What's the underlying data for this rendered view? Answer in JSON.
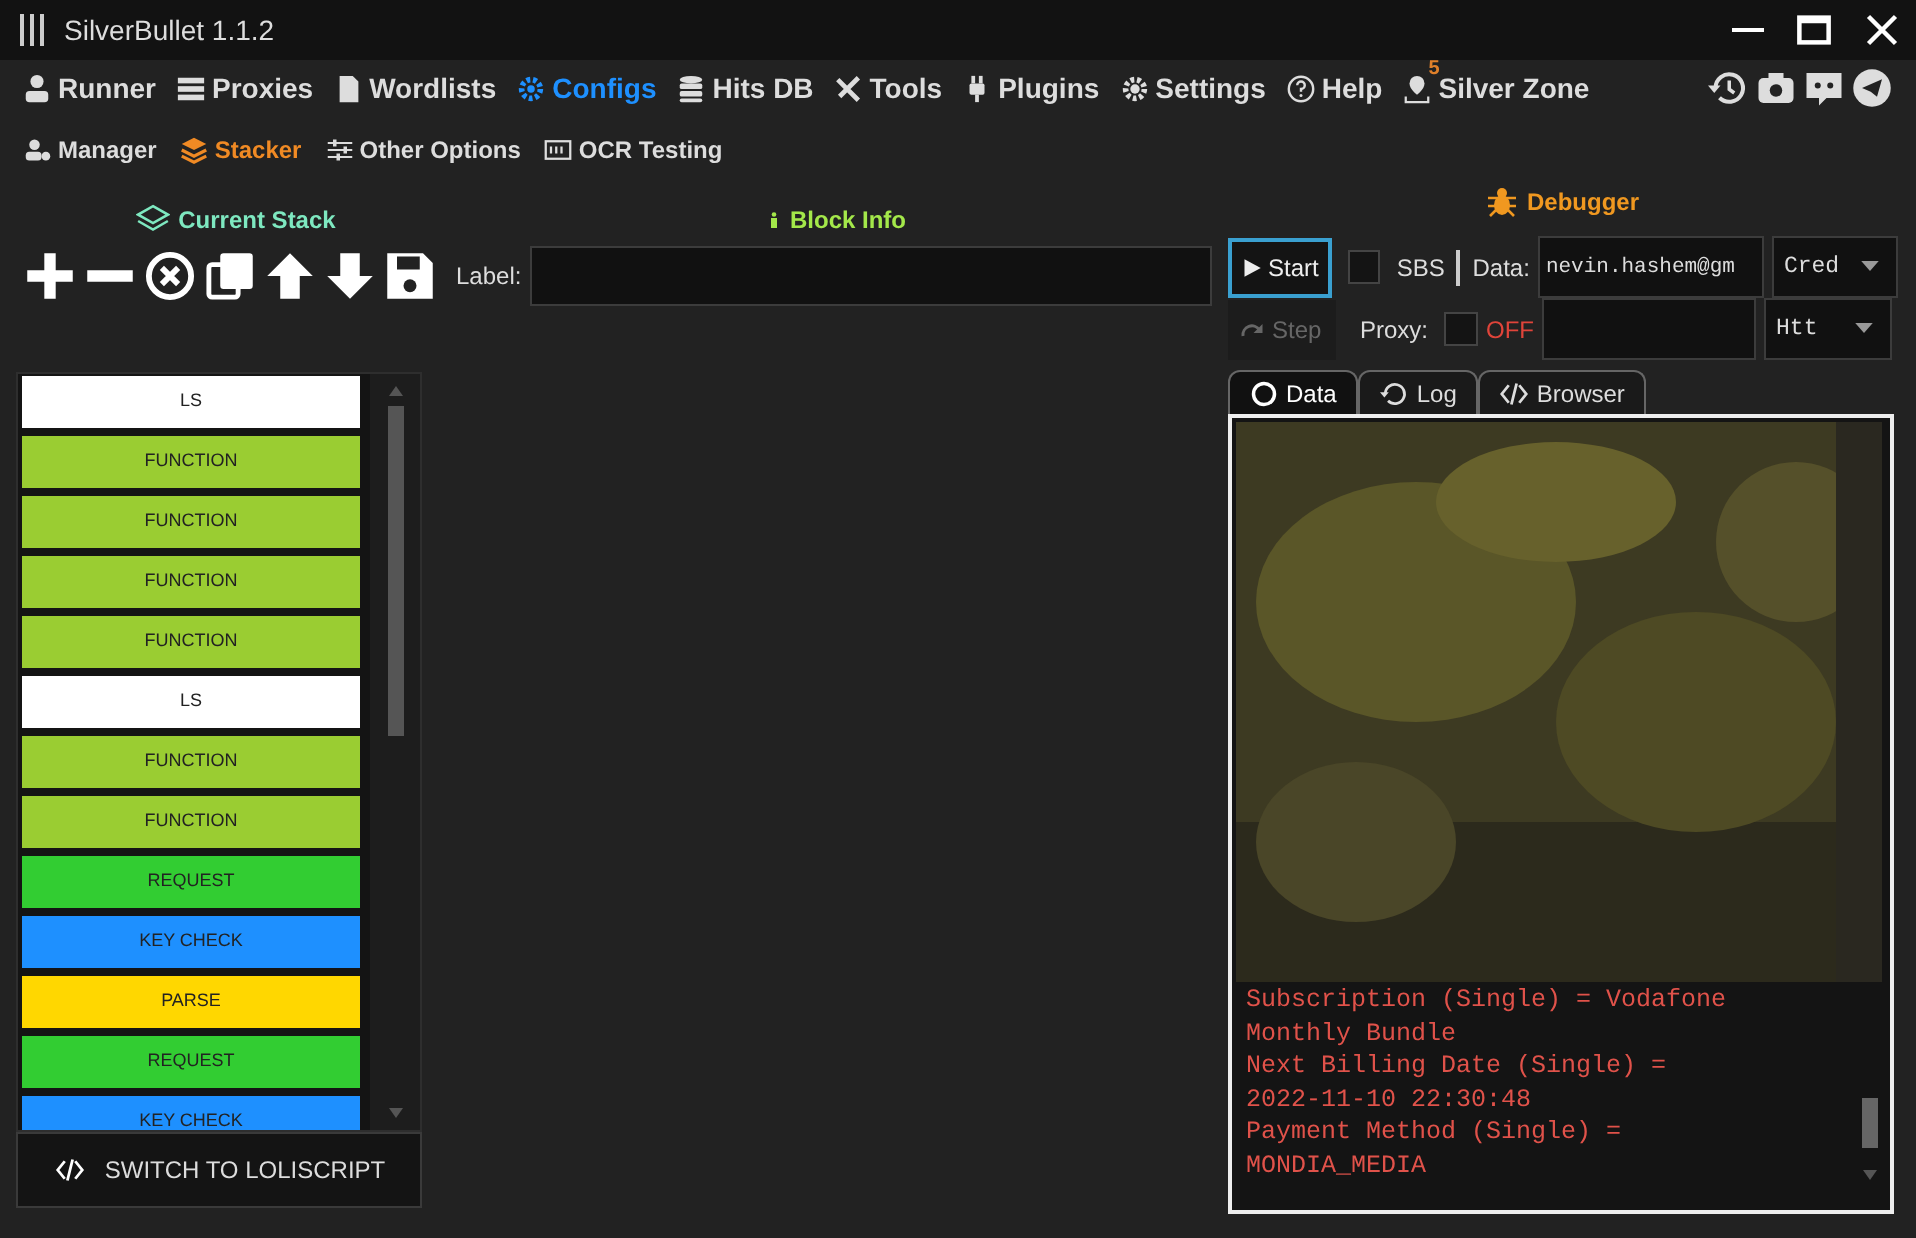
{
  "window": {
    "title": "SilverBullet 1.1.2"
  },
  "main_menu": [
    {
      "label": "Runner",
      "selected": false
    },
    {
      "label": "Proxies",
      "selected": false
    },
    {
      "label": "Wordlists",
      "selected": false
    },
    {
      "label": "Configs",
      "selected": true
    },
    {
      "label": "Hits DB",
      "selected": false
    },
    {
      "label": "Tools",
      "selected": false
    },
    {
      "label": "Plugins",
      "selected": false
    },
    {
      "label": "Settings",
      "selected": false
    },
    {
      "label": "Help",
      "selected": false
    },
    {
      "label": "Silver Zone",
      "selected": false,
      "badge": "5"
    }
  ],
  "sub_menu": [
    {
      "label": "Manager",
      "selected": false
    },
    {
      "label": "Stacker",
      "selected": true
    },
    {
      "label": "Other Options",
      "selected": false
    },
    {
      "label": "OCR Testing",
      "selected": false
    }
  ],
  "current_stack": {
    "title": "Current Stack",
    "blocks": [
      {
        "label": "LS",
        "color": "#ffffff"
      },
      {
        "label": "FUNCTION",
        "color": "#9acd32"
      },
      {
        "label": "FUNCTION",
        "color": "#9acd32"
      },
      {
        "label": "FUNCTION",
        "color": "#9acd32"
      },
      {
        "label": "FUNCTION",
        "color": "#9acd32"
      },
      {
        "label": "LS",
        "color": "#ffffff"
      },
      {
        "label": "FUNCTION",
        "color": "#9acd32"
      },
      {
        "label": "FUNCTION",
        "color": "#9acd32"
      },
      {
        "label": "REQUEST",
        "color": "#32cd32"
      },
      {
        "label": "KEY CHECK",
        "color": "#1e90ff"
      },
      {
        "label": "PARSE",
        "color": "#ffd700"
      },
      {
        "label": "REQUEST",
        "color": "#32cd32"
      },
      {
        "label": "KEY CHECK",
        "color": "#1e90ff"
      }
    ],
    "switch_button": "SWITCH TO LOLISCRIPT"
  },
  "block_info": {
    "title": "Block Info",
    "label_caption": "Label:"
  },
  "debugger": {
    "title": "Debugger",
    "start_button": "Start",
    "sbs": {
      "label": "SBS",
      "checked": false
    },
    "data_caption": "Data:",
    "data_value": "nevin.hashem@gm",
    "data_type": "Cred",
    "step_button": {
      "label": "Step",
      "disabled": true
    },
    "proxy": {
      "label": "Proxy:",
      "checked": false,
      "state": "OFF"
    },
    "proxy_type": "Htt",
    "tabs": [
      {
        "label": "Data",
        "selected": true
      },
      {
        "label": "Log",
        "selected": false
      },
      {
        "label": "Browser",
        "selected": false
      }
    ],
    "output": {
      "lines": [
        "Subscription (Single) = Vodafone",
        "Monthly Bundle",
        "Next Billing Date (Single) =",
        "2022-11-10 22:30:48",
        "Payment Method (Single) =",
        "MONDIA_MEDIA"
      ]
    }
  }
}
